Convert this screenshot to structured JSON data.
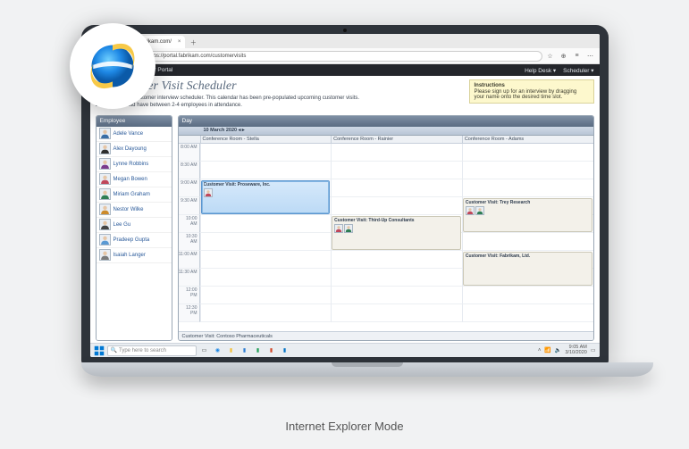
{
  "caption": "Internet Explorer Mode",
  "browser": {
    "tab_title": "https://portal.fabrikam.com/",
    "address": "https://portal.fabrikam.com/customervisits",
    "nav": {
      "back": "←",
      "forward": "→",
      "refresh": "⟳",
      "lock": "🔒"
    },
    "right_icons": [
      "☆",
      "⊕",
      "≡",
      "⋯"
    ]
  },
  "portal": {
    "brand": "Fabrikam Customer Portal",
    "nav": {
      "help": "Help Desk ▾",
      "scheduler": "Scheduler ▾"
    }
  },
  "page": {
    "title": "Customer Visit Scheduler",
    "subtext1": "Welcome to the customer interview scheduler. This calendar has been pre-populated upcoming customer visits.",
    "subtext2": "Each visit should have between 2-4 employees in attendance.",
    "instructions_hd": "Instructions",
    "instructions_body": "Please sign up for an interview by dragging your name onto the desired time slot."
  },
  "employees": {
    "header": "Employee",
    "list": [
      "Adele Vance",
      "Alex Dayoung",
      "Lynne Robbins",
      "Megan Bowen",
      "Miriam Graham",
      "Nestor Wilke",
      "Lee Gu",
      "Pradeep Gupta",
      "Isaiah Langer"
    ]
  },
  "calendar": {
    "header": "Day",
    "date": "10 March 2020 ◂ ▸",
    "rooms": [
      "",
      "Conference Room - Stella",
      "Conference Room - Rainier",
      "Conference Room - Adams"
    ],
    "times": [
      "8:00 AM",
      "8:30 AM",
      "9:00 AM",
      "9:30 AM",
      "10:00 AM",
      "10:30 AM",
      "11:00 AM",
      "11:30 AM",
      "12:00 PM",
      "12:30 PM"
    ],
    "events": [
      {
        "title": "Customer Visit: Proseware, Inc.",
        "room": 0,
        "start": 2,
        "span": 2,
        "style": "ev-sel",
        "avatars": 1
      },
      {
        "title": "Customer Visit: Third-Up Consultants",
        "room": 1,
        "start": 4,
        "span": 2,
        "style": "ev-beige",
        "avatars": 2
      },
      {
        "title": "Customer Visit: Trey Research",
        "room": 2,
        "start": 3,
        "span": 2,
        "style": "ev-beige",
        "avatars": 2
      },
      {
        "title": "Customer Visit: Fabrikam, Ltd.",
        "room": 2,
        "start": 6,
        "span": 2,
        "style": "ev-beige",
        "avatars": 0
      }
    ],
    "footer": "Customer Visit: Contoso Pharmaceuticals"
  },
  "taskbar": {
    "search_placeholder": "Type here to search",
    "time": "9:05 AM",
    "date": "3/10/2020"
  }
}
